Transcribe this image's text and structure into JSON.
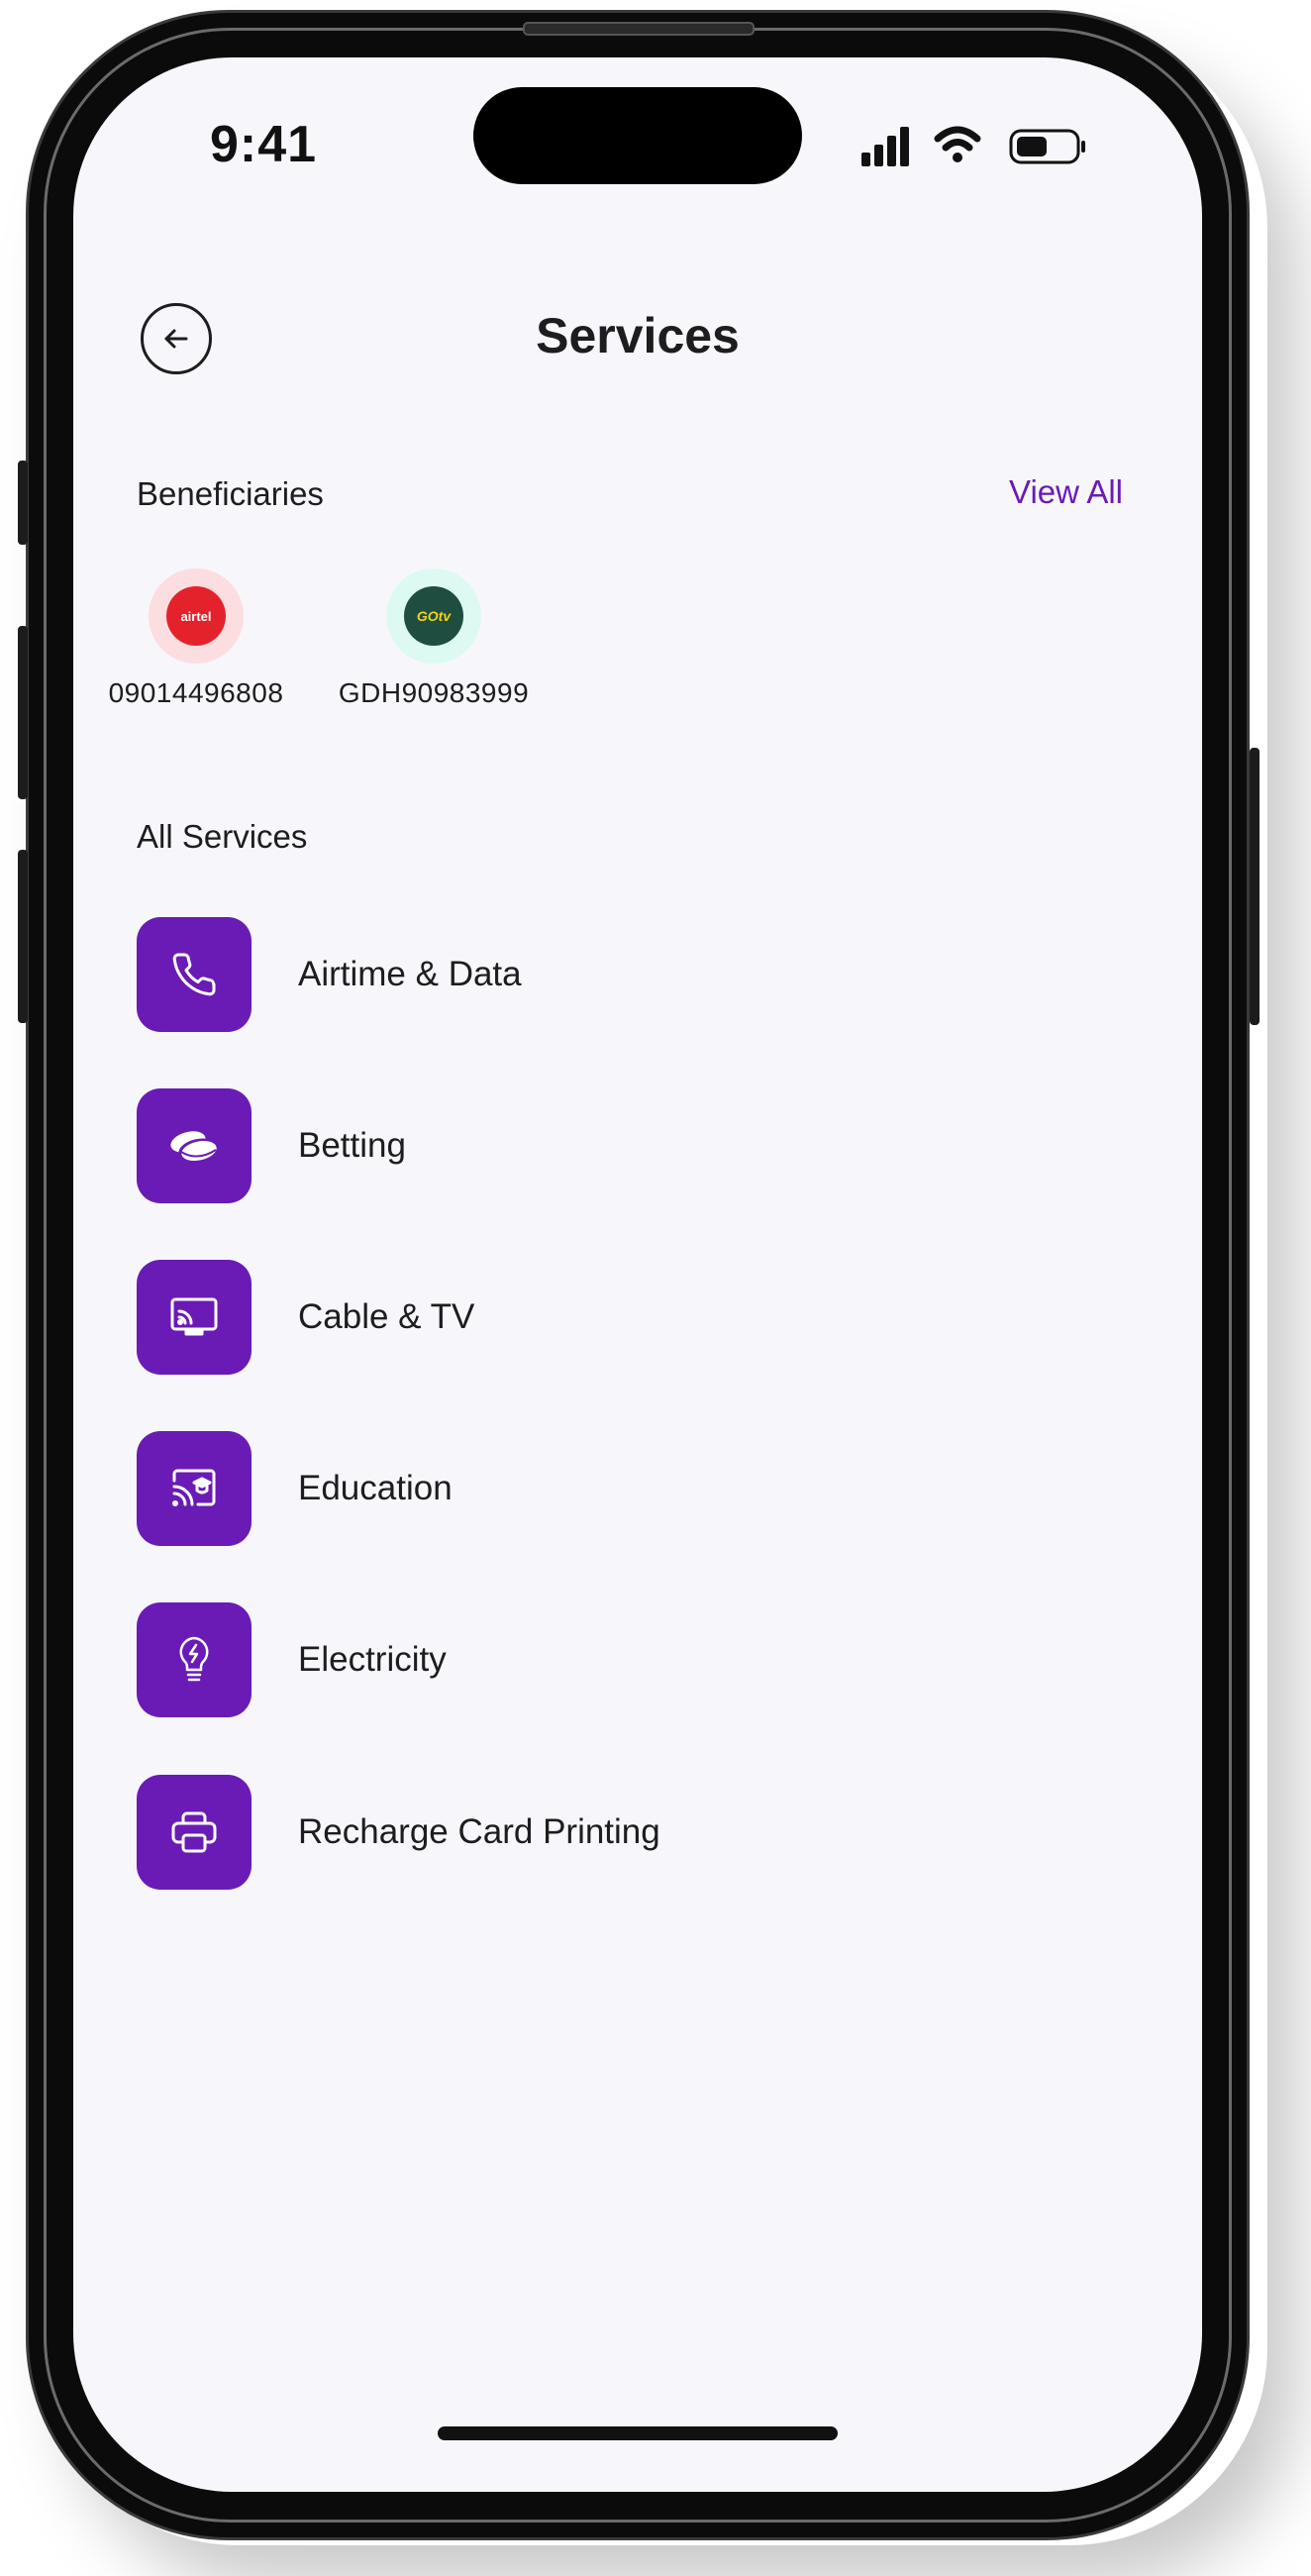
{
  "status_bar": {
    "time": "9:41",
    "icons": [
      "cellular-signal-icon",
      "wifi-icon",
      "battery-icon"
    ]
  },
  "header": {
    "title": "Services",
    "back_icon": "arrow-left-icon"
  },
  "beneficiaries": {
    "label": "Beneficiaries",
    "view_all_label": "View All",
    "items": [
      {
        "id": "09014496808",
        "logo_text": "airtel",
        "logo_name": "airtel-logo",
        "color": "#e4222b"
      },
      {
        "id": "GDH90983999",
        "logo_text": "GOtv",
        "logo_name": "gotv-logo",
        "color": "#1f4d3f"
      }
    ]
  },
  "all_services": {
    "label": "All Services",
    "items": [
      {
        "label": "Airtime & Data",
        "icon": "phone-icon"
      },
      {
        "label": "Betting",
        "icon": "coins-icon"
      },
      {
        "label": "Cable & TV",
        "icon": "cast-tv-icon"
      },
      {
        "label": "Education",
        "icon": "education-cast-icon"
      },
      {
        "label": "Electricity",
        "icon": "lightbulb-icon"
      },
      {
        "label": "Recharge Card Printing",
        "icon": "printer-icon"
      }
    ]
  },
  "colors": {
    "accent": "#6a1bb5",
    "screen_background": "#f7f7fb",
    "text": "#1d1d1f"
  }
}
